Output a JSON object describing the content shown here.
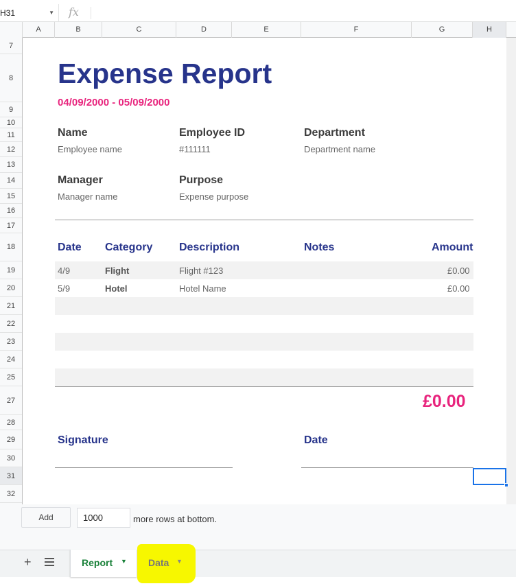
{
  "name_box": "H31",
  "fx_label": "fx",
  "columns": [
    "A",
    "B",
    "C",
    "D",
    "E",
    "F",
    "G",
    "H"
  ],
  "rows": [
    "7",
    "8",
    "9",
    "10",
    "11",
    "12",
    "13",
    "14",
    "15",
    "16",
    "17",
    "18",
    "19",
    "20",
    "21",
    "22",
    "23",
    "24",
    "25",
    "27",
    "28",
    "29",
    "30",
    "31",
    "32"
  ],
  "report": {
    "title": "Expense Report",
    "date_range": "04/09/2000 - 05/09/2000",
    "fields": {
      "name_label": "Name",
      "name_value": "Employee name",
      "employee_id_label": "Employee ID",
      "employee_id_value": "#111111",
      "department_label": "Department",
      "department_value": "Department name",
      "manager_label": "Manager",
      "manager_value": "Manager name",
      "purpose_label": "Purpose",
      "purpose_value": "Expense purpose"
    },
    "table": {
      "headers": {
        "date": "Date",
        "category": "Category",
        "description": "Description",
        "notes": "Notes",
        "amount": "Amount"
      },
      "rows": [
        {
          "date": "4/9",
          "category": "Flight",
          "description": "Flight #123",
          "amount": "£0.00"
        },
        {
          "date": "5/9",
          "category": "Hotel",
          "description": "Hotel Name",
          "amount": "£0.00"
        }
      ]
    },
    "total": "£0.00",
    "signature_label": "Signature",
    "date_label": "Date"
  },
  "add_rows": {
    "button": "Add",
    "count": "1000",
    "suffix": "more rows at bottom."
  },
  "tabs": [
    {
      "label": "Report",
      "active": true
    },
    {
      "label": "Data",
      "active": false
    }
  ],
  "colors": {
    "title": "#27348b",
    "accent": "#e8247d",
    "active_tab": "#188038",
    "highlight": "#f7f700",
    "selection": "#1a73e8"
  }
}
